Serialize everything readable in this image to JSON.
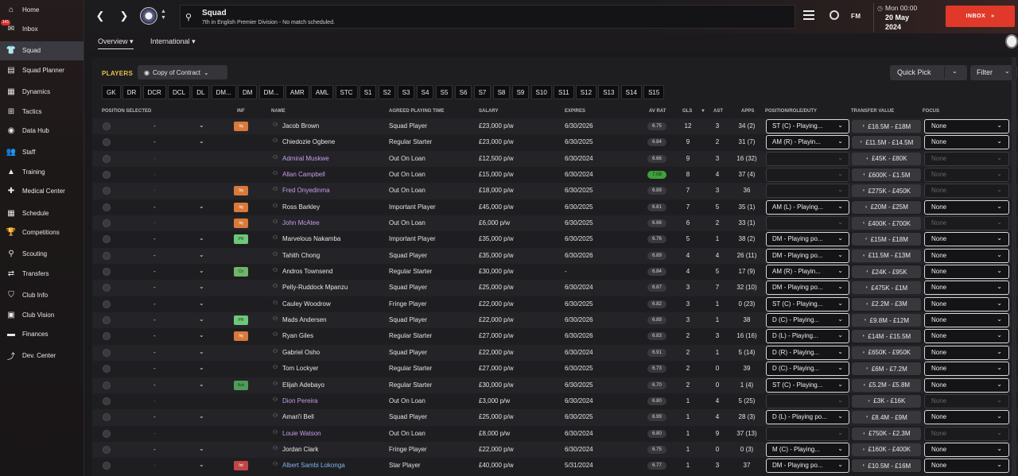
{
  "sidebar": {
    "items": [
      {
        "label": "Home",
        "icon": "home-icon",
        "glyph": "⌂"
      },
      {
        "label": "Inbox",
        "icon": "inbox-icon",
        "glyph": "✉",
        "badge": "141"
      },
      {
        "label": "Squad",
        "icon": "shirt-icon",
        "glyph": "👕"
      },
      {
        "label": "Squad Planner",
        "icon": "clipboard-icon",
        "glyph": "▤"
      },
      {
        "label": "Dynamics",
        "icon": "dynamics-icon",
        "glyph": "▦"
      },
      {
        "label": "Tactics",
        "icon": "tactics-board-icon",
        "glyph": "⊞"
      },
      {
        "label": "Data Hub",
        "icon": "data-hub-icon",
        "glyph": "◉"
      },
      {
        "label": "Staff",
        "icon": "staff-icon",
        "glyph": "👥"
      },
      {
        "label": "Training",
        "icon": "training-cone-icon",
        "glyph": "▲"
      },
      {
        "label": "Medical Center",
        "icon": "medical-kit-icon",
        "glyph": "✚"
      },
      {
        "label": "Schedule",
        "icon": "calendar-icon",
        "glyph": "▦"
      },
      {
        "label": "Competitions",
        "icon": "trophy-icon",
        "glyph": "🏆"
      },
      {
        "label": "Scouting",
        "icon": "magnifier-icon",
        "glyph": "⚲"
      },
      {
        "label": "Transfers",
        "icon": "transfer-arrows-icon",
        "glyph": "⇄"
      },
      {
        "label": "Club Info",
        "icon": "club-shield-icon",
        "glyph": "⛉"
      },
      {
        "label": "Club Vision",
        "icon": "club-vision-icon",
        "glyph": "▣"
      },
      {
        "label": "Finances",
        "icon": "finances-icon",
        "glyph": "▬"
      },
      {
        "label": "Dev. Center",
        "icon": "dev-center-icon",
        "glyph": "⤴"
      }
    ]
  },
  "header": {
    "title": "Squad",
    "subtitle": "7th in English Premier Division - No match scheduled.",
    "logo": "FM",
    "time": "Mon 00:00",
    "date": "20 May",
    "year": "2024",
    "inbox_label": "INBOX"
  },
  "subtabs": [
    {
      "label": "Overview",
      "active": true
    },
    {
      "label": "International",
      "active": false
    }
  ],
  "toolbar": {
    "players_label": "PLAYERS",
    "view": "Copy of Contract",
    "quick_pick": "Quick Pick",
    "filter": "Filter"
  },
  "position_filters": [
    "GK",
    "DR",
    "DCR",
    "DCL",
    "DL",
    "DM...",
    "DM",
    "DM...",
    "AMR",
    "AML",
    "STC",
    "S1",
    "S2",
    "S3",
    "S4",
    "S5",
    "S6",
    "S7",
    "S8",
    "S9",
    "S10",
    "S11",
    "S12",
    "S13",
    "S14",
    "S15"
  ],
  "columns": {
    "position_selected": "POSITION SELECTED",
    "inf": "INF",
    "name": "NAME",
    "agreed_playing_time": "AGREED PLAYING TIME",
    "salary": "SALARY",
    "expires": "EXPIRES",
    "av_rat": "AV RAT",
    "gls": "GLS",
    "ast": "AST",
    "apps": "APPS",
    "position_role_duty": "POSITION/ROLE/DUTY",
    "transfer_value": "TRANSFER VALUE",
    "focus": "FOCUS"
  },
  "colors": {
    "accent": "#e9c04a",
    "inbox": "#e0392a",
    "loan_name": "#c79de8",
    "link_name": "#7fb4ee"
  },
  "players": [
    {
      "pos": "-",
      "inf": "Inj",
      "name": "Jacob Brown",
      "style": "",
      "apt": "Squad Player",
      "salary": "£23,000 p/w",
      "expires": "6/30/2026",
      "rat": "6.75",
      "gls": "12",
      "ast": "3",
      "apps": "34 (2)",
      "prd": "ST (C) - Playing...",
      "tv": "£16.5M - £18M",
      "focus": "None"
    },
    {
      "pos": "-",
      "inf": "",
      "name": "Chiedozie Ogbene",
      "style": "",
      "apt": "Regular Starter",
      "salary": "£23,000 p/w",
      "expires": "6/30/2025",
      "rat": "6.84",
      "gls": "9",
      "ast": "2",
      "apps": "31 (7)",
      "prd": "AM (R) - Playin...",
      "tv": "£11.5M - £14.5M",
      "focus": "None"
    },
    {
      "pos": "-",
      "inf": "",
      "name": "Admiral Muskwe",
      "style": "loan",
      "apt": "Out On Loan",
      "salary": "£12,500 p/w",
      "expires": "6/30/2024",
      "rat": "6.66",
      "gls": "9",
      "ast": "3",
      "apps": "16 (32)",
      "prd": "",
      "tv": "£45K - £80K",
      "focus": "None"
    },
    {
      "pos": "-",
      "inf": "",
      "name": "Allan Campbell",
      "style": "loan",
      "apt": "Out On Loan",
      "salary": "£15,000 p/w",
      "expires": "6/30/2024",
      "rat": "7.08",
      "gls": "8",
      "ast": "4",
      "apps": "37 (4)",
      "prd": "",
      "tv": "£600K - £1.5M",
      "focus": "None"
    },
    {
      "pos": "-",
      "inf": "Inj",
      "name": "Fred Onyedinma",
      "style": "loan",
      "apt": "Out On Loan",
      "salary": "£18,000 p/w",
      "expires": "6/30/2025",
      "rat": "6.89",
      "gls": "7",
      "ast": "3",
      "apps": "36",
      "prd": "",
      "tv": "£275K - £450K",
      "focus": "None"
    },
    {
      "pos": "-",
      "inf": "Inj",
      "name": "Ross Barkley",
      "style": "",
      "apt": "Important Player",
      "salary": "£45,000 p/w",
      "expires": "6/30/2025",
      "rat": "6.81",
      "gls": "7",
      "ast": "5",
      "apps": "35 (1)",
      "prd": "AM (L) - Playing...",
      "tv": "£20M - £25M",
      "focus": "None"
    },
    {
      "pos": "-",
      "inf": "Inj",
      "name": "John McAtee",
      "style": "loan",
      "apt": "Out On Loan",
      "salary": "£6,000 p/w",
      "expires": "6/30/2025",
      "rat": "6.66",
      "gls": "6",
      "ast": "2",
      "apps": "33 (1)",
      "prd": "",
      "tv": "£400K - £700K",
      "focus": "None"
    },
    {
      "pos": "-",
      "inf": "PR",
      "name": "Marvelous Nakamba",
      "style": "",
      "apt": "Important Player",
      "salary": "£35,000 p/w",
      "expires": "6/30/2025",
      "rat": "6.76",
      "gls": "5",
      "ast": "1",
      "apps": "38 (2)",
      "prd": "DM - Playing po...",
      "tv": "£15M - £18M",
      "focus": "None"
    },
    {
      "pos": "-",
      "inf": "",
      "name": "Tahith Chong",
      "style": "",
      "apt": "Squad Player",
      "salary": "£35,000 p/w",
      "expires": "6/30/2026",
      "rat": "6.89",
      "gls": "4",
      "ast": "4",
      "apps": "26 (11)",
      "prd": "DM - Playing po...",
      "tv": "£11.5M - £13M",
      "focus": "None"
    },
    {
      "pos": "-",
      "inf": "Ctr",
      "name": "Andros Townsend",
      "style": "",
      "apt": "Regular Starter",
      "salary": "£30,000 p/w",
      "expires": "-",
      "rat": "6.84",
      "gls": "4",
      "ast": "5",
      "apps": "17 (9)",
      "prd": "AM (R) - Playin...",
      "tv": "£24K - £95K",
      "focus": "None"
    },
    {
      "pos": "-",
      "inf": "",
      "name": "Pelly-Ruddock Mpanzu",
      "style": "",
      "apt": "Squad Player",
      "salary": "£25,000 p/w",
      "expires": "6/30/2024",
      "rat": "6.87",
      "gls": "3",
      "ast": "7",
      "apps": "32 (10)",
      "prd": "DM - Playing po...",
      "tv": "£475K - £1M",
      "focus": "None"
    },
    {
      "pos": "-",
      "inf": "",
      "name": "Cauley Woodrow",
      "style": "",
      "apt": "Fringe Player",
      "salary": "£22,000 p/w",
      "expires": "6/30/2025",
      "rat": "6.82",
      "gls": "3",
      "ast": "1",
      "apps": "0 (23)",
      "prd": "ST (C) - Playing...",
      "tv": "£2.2M - £3M",
      "focus": "None"
    },
    {
      "pos": "-",
      "inf": "PR",
      "name": "Mads Andersen",
      "style": "",
      "apt": "Squad Player",
      "salary": "£22,000 p/w",
      "expires": "6/30/2026",
      "rat": "6.89",
      "gls": "3",
      "ast": "1",
      "apps": "38",
      "prd": "D (C) - Playing...",
      "tv": "£9.8M - £12M",
      "focus": "None"
    },
    {
      "pos": "-",
      "inf": "Inj",
      "name": "Ryan Giles",
      "style": "",
      "apt": "Regular Starter",
      "salary": "£27,000 p/w",
      "expires": "6/30/2026",
      "rat": "6.83",
      "gls": "2",
      "ast": "3",
      "apps": "16 (16)",
      "prd": "D (L) - Playing...",
      "tv": "£14M - £15.5M",
      "focus": "None"
    },
    {
      "pos": "-",
      "inf": "",
      "name": "Gabriel Osho",
      "style": "",
      "apt": "Squad Player",
      "salary": "£22,000 p/w",
      "expires": "6/30/2024",
      "rat": "6.91",
      "gls": "2",
      "ast": "1",
      "apps": "5 (14)",
      "prd": "D (R) - Playing...",
      "tv": "£650K - £950K",
      "focus": "None"
    },
    {
      "pos": "-",
      "inf": "",
      "name": "Tom Lockyer",
      "style": "",
      "apt": "Regular Starter",
      "salary": "£27,000 p/w",
      "expires": "6/30/2025",
      "rat": "6.73",
      "gls": "2",
      "ast": "0",
      "apps": "39",
      "prd": "D (C) - Playing...",
      "tv": "£6M - £7.2M",
      "focus": "None"
    },
    {
      "pos": "-",
      "inf": "Ask",
      "name": "Elijah Adebayo",
      "style": "",
      "apt": "Regular Starter",
      "salary": "£30,000 p/w",
      "expires": "6/30/2025",
      "rat": "6.70",
      "gls": "2",
      "ast": "0",
      "apps": "1 (4)",
      "prd": "ST (C) - Playing...",
      "tv": "£5.2M - £5.8M",
      "focus": "None"
    },
    {
      "pos": "-",
      "inf": "",
      "name": "Dion Pereira",
      "style": "loan",
      "apt": "Out On Loan",
      "salary": "£3,000 p/w",
      "expires": "6/30/2024",
      "rat": "6.80",
      "gls": "1",
      "ast": "4",
      "apps": "5 (25)",
      "prd": "",
      "tv": "£3K - £16K",
      "focus": "None"
    },
    {
      "pos": "-",
      "inf": "",
      "name": "Amari'i Bell",
      "style": "",
      "apt": "Squad Player",
      "salary": "£25,000 p/w",
      "expires": "6/30/2025",
      "rat": "6.99",
      "gls": "1",
      "ast": "4",
      "apps": "28 (3)",
      "prd": "D (L) - Playing po...",
      "tv": "£8.4M - £9M",
      "focus": "None"
    },
    {
      "pos": "-",
      "inf": "",
      "name": "Louie Watson",
      "style": "loan",
      "apt": "Out On Loan",
      "salary": "£8,000 p/w",
      "expires": "6/30/2024",
      "rat": "6.80",
      "gls": "1",
      "ast": "9",
      "apps": "37 (13)",
      "prd": "",
      "tv": "£750K - £2.3M",
      "focus": "None"
    },
    {
      "pos": "-",
      "inf": "",
      "name": "Jordan Clark",
      "style": "",
      "apt": "Fringe Player",
      "salary": "£22,000 p/w",
      "expires": "6/30/2024",
      "rat": "6.75",
      "gls": "1",
      "ast": "0",
      "apps": "0 (3)",
      "prd": "M (C) - Playing...",
      "tv": "£160K - £400K",
      "focus": "None"
    },
    {
      "pos": "-",
      "inf": "Int",
      "name": "Albert Sambi Lokonga",
      "style": "link",
      "apt": "Star Player",
      "salary": "£40,000 p/w",
      "expires": "5/31/2024",
      "rat": "6.77",
      "gls": "1",
      "ast": "3",
      "apps": "37",
      "prd": "DM - Playing po...",
      "tv": "£10.5M - £16M",
      "focus": "None"
    }
  ]
}
